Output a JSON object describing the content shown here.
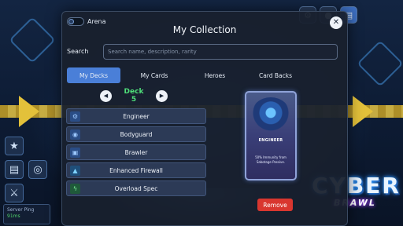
{
  "background": {
    "top_icons": [
      {
        "icon": "settings-icon",
        "glyph": "⚙"
      },
      {
        "icon": "profile-icon",
        "glyph": "●"
      },
      {
        "icon": "cards-icon",
        "glyph": "▤"
      }
    ],
    "side_icons": [
      {
        "icon": "trophy-icon",
        "glyph": "★"
      },
      {
        "icon": "cards-stack-icon",
        "glyph": "▤"
      },
      {
        "icon": "coins-icon",
        "glyph": "◎"
      },
      {
        "icon": "battle-icon",
        "glyph": "⚔"
      }
    ],
    "ping": {
      "label": "Server Ping",
      "value": "91ms"
    },
    "logo": {
      "line1": "CYBER",
      "line2": "BRAWL"
    }
  },
  "modal": {
    "arena_label": "Arena",
    "title": "My Collection",
    "close_glyph": "✕",
    "search": {
      "label": "Search",
      "placeholder": "Search name, description, rarity",
      "value": ""
    },
    "tabs": [
      {
        "label": "My Decks",
        "active": true
      },
      {
        "label": "My Cards",
        "active": false
      },
      {
        "label": "Heroes",
        "active": false
      },
      {
        "label": "Card Backs",
        "active": false
      }
    ],
    "deck": {
      "prev_glyph": "◀",
      "next_glyph": "▶",
      "name": "Deck 5"
    },
    "cards": [
      {
        "label": "Engineer",
        "icon": "gear-icon",
        "glyph": "⚙",
        "color": "#3f7fd8"
      },
      {
        "label": "Bodyguard",
        "icon": "shield-icon",
        "glyph": "◉",
        "color": "#3f7fd8"
      },
      {
        "label": "Brawler",
        "icon": "fist-icon",
        "glyph": "▣",
        "color": "#3f7fd8"
      },
      {
        "label": "Enhanced Firewall",
        "icon": "firewall-icon",
        "glyph": "▲",
        "color": "#2fa0d8"
      },
      {
        "label": "Overload Spec",
        "icon": "lightning-icon",
        "glyph": "ϟ",
        "color": "#3bbd5a"
      }
    ],
    "preview": {
      "name": "ENGINEER",
      "description": "50% Immunity from Sabotage Passive."
    },
    "remove_label": "Remove"
  }
}
